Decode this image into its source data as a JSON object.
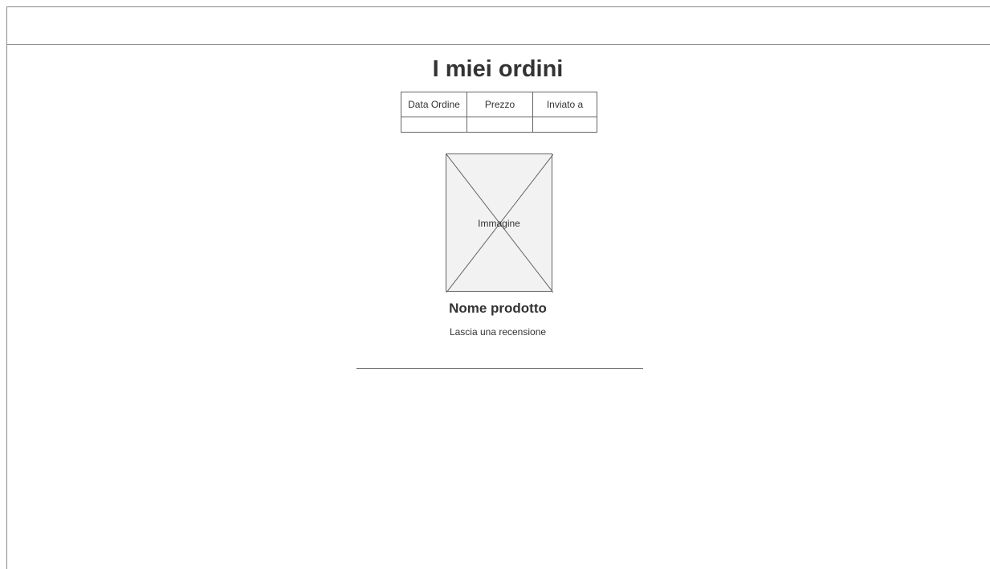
{
  "page": {
    "title": "I miei ordini"
  },
  "orders_table": {
    "headers": [
      "Data Ordine",
      "Prezzo",
      "Inviato a"
    ],
    "rows": [
      [
        "",
        "",
        ""
      ]
    ]
  },
  "product": {
    "image_label": "Immagine",
    "image_icon": "image-placeholder-icon",
    "name": "Nome prodotto",
    "review_link": "Lascia una recensione"
  },
  "colors": {
    "text": "#333333",
    "border": "#666666",
    "image_fill": "#f2f2f2"
  }
}
